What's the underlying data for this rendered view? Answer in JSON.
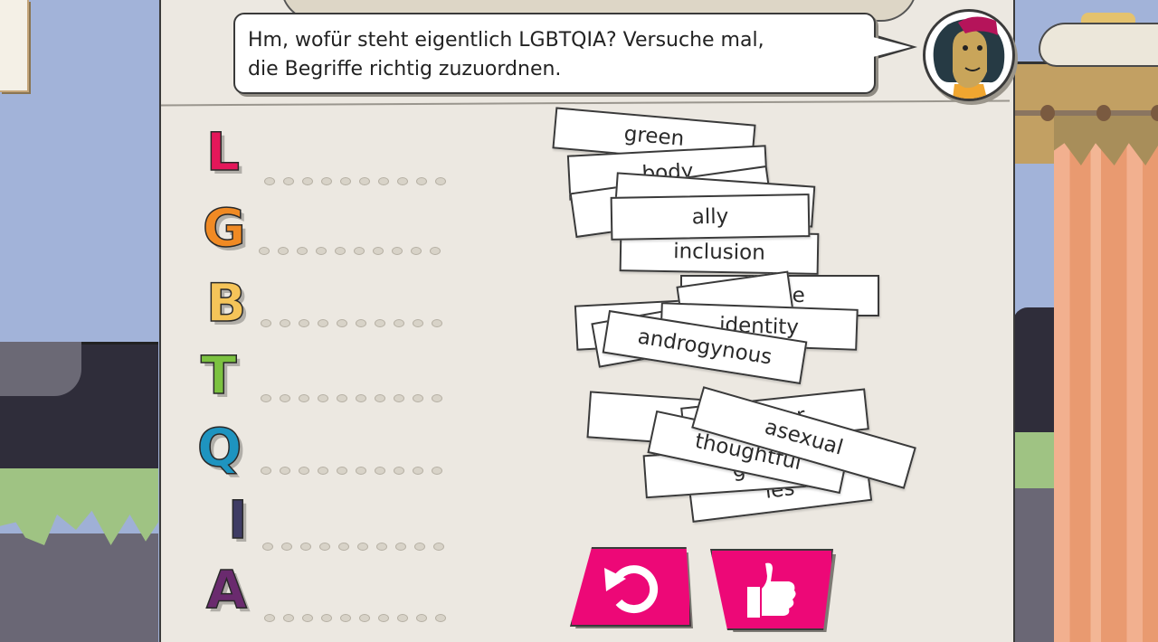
{
  "speech_bubble": {
    "line1": "Hm, wofür steht eigentlich LGBTQIA? Versuche mal,",
    "line2": "die Begriffe richtig zuzuordnen."
  },
  "avatar": {
    "icon": "character-portrait-icon"
  },
  "letters": [
    {
      "char": "L",
      "color": "#e4175a"
    },
    {
      "char": "G",
      "color": "#f08a24"
    },
    {
      "char": "B",
      "color": "#f5c459"
    },
    {
      "char": "T",
      "color": "#7cc240"
    },
    {
      "char": "Q",
      "color": "#1e94c0"
    },
    {
      "char": "I",
      "color": "#3f3c64"
    },
    {
      "char": "A",
      "color": "#6a2a6e"
    }
  ],
  "cards": [
    {
      "text": "green"
    },
    {
      "text": "body"
    },
    {
      "text": ""
    },
    {
      "text": ""
    },
    {
      "text": "inclusion"
    },
    {
      "text": "ally"
    },
    {
      "text": "ance"
    },
    {
      "text": ""
    },
    {
      "text": ""
    },
    {
      "text": ""
    },
    {
      "text": "identity"
    },
    {
      "text": "androgynous"
    },
    {
      "text": ""
    },
    {
      "text": "les"
    },
    {
      "text": "g"
    },
    {
      "text": "queer"
    },
    {
      "text": "thoughtful"
    },
    {
      "text": "asexual"
    }
  ],
  "buttons": {
    "reset": {
      "icon": "reset-icon"
    },
    "confirm": {
      "icon": "thumbs-up-icon"
    }
  },
  "colors": {
    "button_pink": "#ed0877",
    "board": "#ece8e1",
    "wall": "#a2b3d9"
  }
}
